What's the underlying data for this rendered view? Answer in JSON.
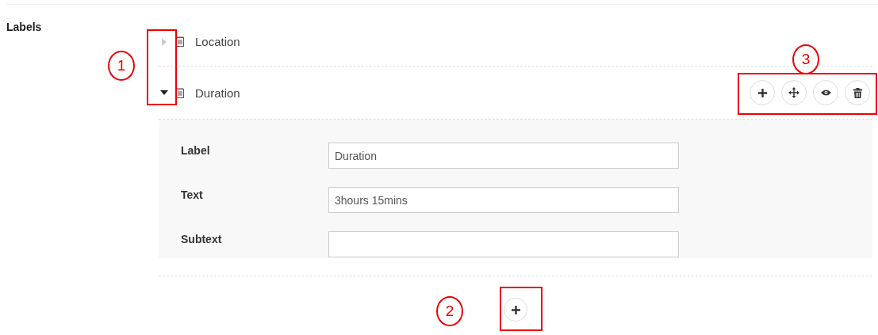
{
  "section_label": "Labels",
  "items": [
    {
      "label": "Location",
      "expanded": false
    },
    {
      "label": "Duration",
      "expanded": true,
      "fields": [
        {
          "label": "Label",
          "value": "Duration"
        },
        {
          "label": "Text",
          "value": "3hours 15mins"
        },
        {
          "label": "Subtext"
        }
      ]
    }
  ],
  "annotations": [
    {
      "number": "1"
    },
    {
      "number": "2"
    },
    {
      "number": "3"
    }
  ]
}
